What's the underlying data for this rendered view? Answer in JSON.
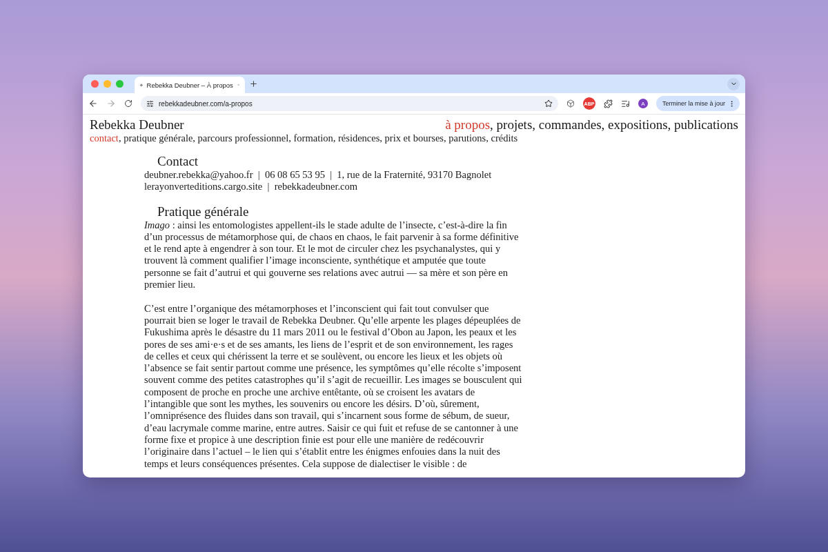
{
  "browser": {
    "tab": {
      "title": "Rebekka Deubner – À propos",
      "selected": true
    },
    "url": "rebekkadeubner.com/a-propos",
    "extension_badge": "ABP",
    "avatar": "A",
    "update_button": "Terminer la mise à jour"
  },
  "site": {
    "name": "Rebekka Deubner",
    "separator": ",",
    "main_nav": [
      {
        "label": "à propos",
        "selected": true
      },
      {
        "label": "projets",
        "selected": false
      },
      {
        "label": "commandes",
        "selected": false
      },
      {
        "label": "expositions",
        "selected": false
      },
      {
        "label": "publications",
        "selected": false
      }
    ],
    "sub_nav": [
      {
        "label": "contact",
        "selected": true
      },
      {
        "label": "pratique générale",
        "selected": false
      },
      {
        "label": "parcours professionnel",
        "selected": false
      },
      {
        "label": "formation",
        "selected": false
      },
      {
        "label": "résidences",
        "selected": false
      },
      {
        "label": "prix et bourses",
        "selected": false
      },
      {
        "label": "parutions",
        "selected": false
      },
      {
        "label": "crédits",
        "selected": false
      }
    ]
  },
  "sections": [
    {
      "heading": "Contact",
      "lines": [
        "deubner.rebekka@yahoo.fr  |  06 08 65 53 95  |  1, rue de la Fraternité, 93170 Bagnolet",
        "lerayonverteditions.cargo.site  |  rebekkadeubner.com"
      ]
    },
    {
      "heading": "Pratique générale",
      "paragraphs": [
        "*Imago* : ainsi les entomologistes appellent-ils le stade adulte de l’insecte, c’est-à-dire la fin d’un processus de métamorphose qui, de chaos en chaos, le fait parvenir à sa forme définitive et le rend apte à engendrer à son tour. Et le mot de circuler chez les psychanalystes, qui y trouvent là comment qualifier l’image inconsciente, synthétique et amputée que toute personne se fait d’autrui et qui gouverne ses relations avec autrui — sa mère et son père en premier lieu.",
        "C’est entre l’organique des métamorphoses et l’inconscient qui fait tout convulser que pourrait bien se loger le travail de Rebekka Deubner. Qu’elle arpente les plages dépeuplées de Fukushima après le désastre du 11 mars 2011 ou le festival d’Obon au Japon, les peaux et les pores de ses ami·e·s et de ses amants, les liens de l’esprit et de son environnement, les rages de celles et ceux qui chérissent la terre et se soulèvent, ou encore les lieux et les objets où l’absence se fait sentir partout comme une présence, les symptômes qu’elle récolte s’imposent souvent comme des petites catastrophes qu’il s’agit de recueillir. Les images se bousculent qui composent de proche en proche une archive entêtante, où se croisent les avatars de l’intangible que sont les mythes, les souvenirs ou encore les désirs. D’où, sûrement, l’omniprésence des fluides dans son travail, qui s’incarnent sous forme de sébum, de sueur, d’eau lacrymale comme marine, entre autres. Saisir ce qui fuit et refuse de se cantonner à une forme fixe et propice à une description finie est pour elle une manière de redécouvrir l’originaire dans l’actuel – le lien qui s’établit entre les énigmes enfouies dans la nuit des temps et leurs conséquences présentes. Cela suppose de dialectiser le visible : de"
      ]
    }
  ]
}
